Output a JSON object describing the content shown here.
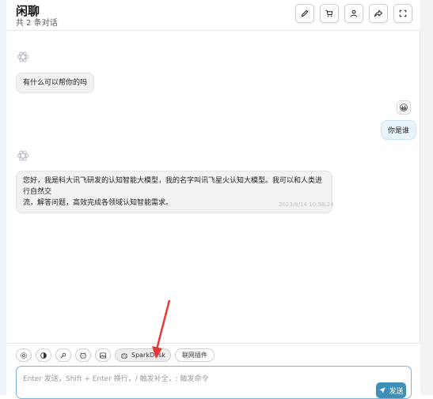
{
  "header": {
    "title": "闲聊",
    "subtitle": "共 2 条对话",
    "toolbar": [
      "edit-icon",
      "cart-icon",
      "user-icon",
      "share-icon",
      "fullscreen-icon"
    ]
  },
  "messages": [
    {
      "role": "assistant",
      "text": "有什么可以帮你的吗"
    },
    {
      "role": "user",
      "avatar": "😀",
      "text": "你是谁"
    },
    {
      "role": "assistant",
      "line1": "您好，我是科大讯飞研发的认知智能大模型，我的名字叫讯飞星火认知大模型。我可以和人类进行自然交",
      "line2": "流，解答问题，高效完成各领域认知智能需求。",
      "timestamp": "2023/8/14 10:58:24"
    }
  ],
  "input": {
    "chips": [
      "settings-icon",
      "theme-icon",
      "prompt-icon",
      "mask-icon",
      "image-icon"
    ],
    "model_label": "SparkDesk",
    "plugin_label": "联网插件",
    "placeholder": "Enter 发送，Shift + Enter 换行，/ 触发补全，: 触发命令",
    "send_label": "发送"
  },
  "colors": {
    "accent": "#3f8fb7",
    "annotation_arrow": "#e53935"
  }
}
